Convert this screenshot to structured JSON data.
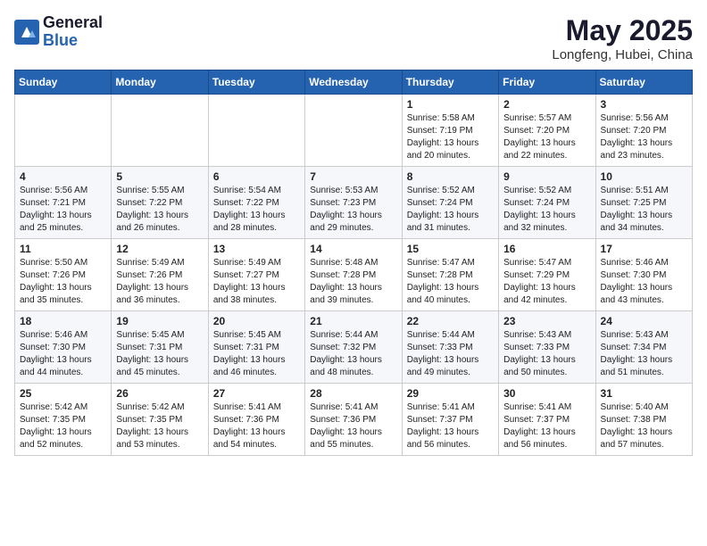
{
  "logo": {
    "general": "General",
    "blue": "Blue"
  },
  "title": "May 2025",
  "location": "Longfeng, Hubei, China",
  "days_of_week": [
    "Sunday",
    "Monday",
    "Tuesday",
    "Wednesday",
    "Thursday",
    "Friday",
    "Saturday"
  ],
  "weeks": [
    [
      {
        "day": "",
        "info": ""
      },
      {
        "day": "",
        "info": ""
      },
      {
        "day": "",
        "info": ""
      },
      {
        "day": "",
        "info": ""
      },
      {
        "day": "1",
        "info": "Sunrise: 5:58 AM\nSunset: 7:19 PM\nDaylight: 13 hours\nand 20 minutes."
      },
      {
        "day": "2",
        "info": "Sunrise: 5:57 AM\nSunset: 7:20 PM\nDaylight: 13 hours\nand 22 minutes."
      },
      {
        "day": "3",
        "info": "Sunrise: 5:56 AM\nSunset: 7:20 PM\nDaylight: 13 hours\nand 23 minutes."
      }
    ],
    [
      {
        "day": "4",
        "info": "Sunrise: 5:56 AM\nSunset: 7:21 PM\nDaylight: 13 hours\nand 25 minutes."
      },
      {
        "day": "5",
        "info": "Sunrise: 5:55 AM\nSunset: 7:22 PM\nDaylight: 13 hours\nand 26 minutes."
      },
      {
        "day": "6",
        "info": "Sunrise: 5:54 AM\nSunset: 7:22 PM\nDaylight: 13 hours\nand 28 minutes."
      },
      {
        "day": "7",
        "info": "Sunrise: 5:53 AM\nSunset: 7:23 PM\nDaylight: 13 hours\nand 29 minutes."
      },
      {
        "day": "8",
        "info": "Sunrise: 5:52 AM\nSunset: 7:24 PM\nDaylight: 13 hours\nand 31 minutes."
      },
      {
        "day": "9",
        "info": "Sunrise: 5:52 AM\nSunset: 7:24 PM\nDaylight: 13 hours\nand 32 minutes."
      },
      {
        "day": "10",
        "info": "Sunrise: 5:51 AM\nSunset: 7:25 PM\nDaylight: 13 hours\nand 34 minutes."
      }
    ],
    [
      {
        "day": "11",
        "info": "Sunrise: 5:50 AM\nSunset: 7:26 PM\nDaylight: 13 hours\nand 35 minutes."
      },
      {
        "day": "12",
        "info": "Sunrise: 5:49 AM\nSunset: 7:26 PM\nDaylight: 13 hours\nand 36 minutes."
      },
      {
        "day": "13",
        "info": "Sunrise: 5:49 AM\nSunset: 7:27 PM\nDaylight: 13 hours\nand 38 minutes."
      },
      {
        "day": "14",
        "info": "Sunrise: 5:48 AM\nSunset: 7:28 PM\nDaylight: 13 hours\nand 39 minutes."
      },
      {
        "day": "15",
        "info": "Sunrise: 5:47 AM\nSunset: 7:28 PM\nDaylight: 13 hours\nand 40 minutes."
      },
      {
        "day": "16",
        "info": "Sunrise: 5:47 AM\nSunset: 7:29 PM\nDaylight: 13 hours\nand 42 minutes."
      },
      {
        "day": "17",
        "info": "Sunrise: 5:46 AM\nSunset: 7:30 PM\nDaylight: 13 hours\nand 43 minutes."
      }
    ],
    [
      {
        "day": "18",
        "info": "Sunrise: 5:46 AM\nSunset: 7:30 PM\nDaylight: 13 hours\nand 44 minutes."
      },
      {
        "day": "19",
        "info": "Sunrise: 5:45 AM\nSunset: 7:31 PM\nDaylight: 13 hours\nand 45 minutes."
      },
      {
        "day": "20",
        "info": "Sunrise: 5:45 AM\nSunset: 7:31 PM\nDaylight: 13 hours\nand 46 minutes."
      },
      {
        "day": "21",
        "info": "Sunrise: 5:44 AM\nSunset: 7:32 PM\nDaylight: 13 hours\nand 48 minutes."
      },
      {
        "day": "22",
        "info": "Sunrise: 5:44 AM\nSunset: 7:33 PM\nDaylight: 13 hours\nand 49 minutes."
      },
      {
        "day": "23",
        "info": "Sunrise: 5:43 AM\nSunset: 7:33 PM\nDaylight: 13 hours\nand 50 minutes."
      },
      {
        "day": "24",
        "info": "Sunrise: 5:43 AM\nSunset: 7:34 PM\nDaylight: 13 hours\nand 51 minutes."
      }
    ],
    [
      {
        "day": "25",
        "info": "Sunrise: 5:42 AM\nSunset: 7:35 PM\nDaylight: 13 hours\nand 52 minutes."
      },
      {
        "day": "26",
        "info": "Sunrise: 5:42 AM\nSunset: 7:35 PM\nDaylight: 13 hours\nand 53 minutes."
      },
      {
        "day": "27",
        "info": "Sunrise: 5:41 AM\nSunset: 7:36 PM\nDaylight: 13 hours\nand 54 minutes."
      },
      {
        "day": "28",
        "info": "Sunrise: 5:41 AM\nSunset: 7:36 PM\nDaylight: 13 hours\nand 55 minutes."
      },
      {
        "day": "29",
        "info": "Sunrise: 5:41 AM\nSunset: 7:37 PM\nDaylight: 13 hours\nand 56 minutes."
      },
      {
        "day": "30",
        "info": "Sunrise: 5:41 AM\nSunset: 7:37 PM\nDaylight: 13 hours\nand 56 minutes."
      },
      {
        "day": "31",
        "info": "Sunrise: 5:40 AM\nSunset: 7:38 PM\nDaylight: 13 hours\nand 57 minutes."
      }
    ]
  ]
}
